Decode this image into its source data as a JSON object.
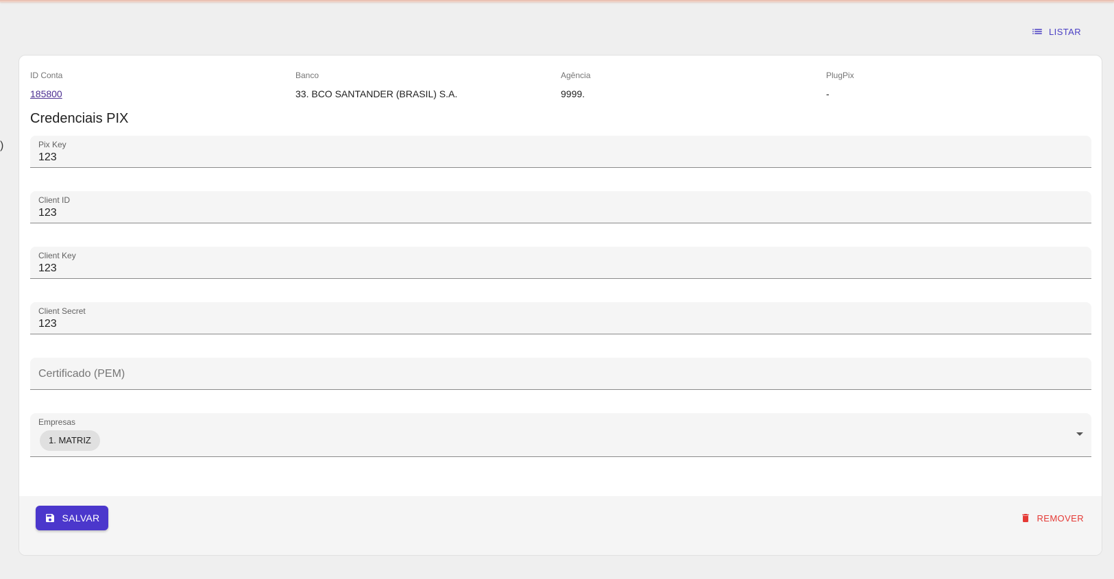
{
  "header": {
    "side_fragment": ")",
    "listar_label": "LISTAR"
  },
  "info": {
    "columns": [
      {
        "label": "ID Conta",
        "value": "185800"
      },
      {
        "label": "Banco",
        "value": "33. BCO SANTANDER (BRASIL) S.A."
      },
      {
        "label": "Agência",
        "value": "9999."
      },
      {
        "label": "PlugPix",
        "value": "-"
      }
    ]
  },
  "section": {
    "title": "Credenciais PIX"
  },
  "fields": {
    "pix_key": {
      "label": "Pix Key",
      "value": "123"
    },
    "client_id": {
      "label": "Client ID",
      "value": "123"
    },
    "client_key": {
      "label": "Client Key",
      "value": "123"
    },
    "client_secret": {
      "label": "Client Secret",
      "value": "123"
    },
    "certificado": {
      "placeholder": "Certificado (PEM)"
    },
    "empresas": {
      "label": "Empresas",
      "selected": "1. MATRIZ"
    }
  },
  "footer": {
    "save_label": "SALVAR",
    "remove_label": "REMOVER"
  },
  "colors": {
    "accent": "#4b37cc",
    "danger": "#e53935",
    "link": "#4b2e91"
  },
  "icons": {
    "listar": "list-icon",
    "save": "floppy-disk-icon",
    "remove": "trash-icon",
    "dropdown": "chevron-down-icon"
  }
}
